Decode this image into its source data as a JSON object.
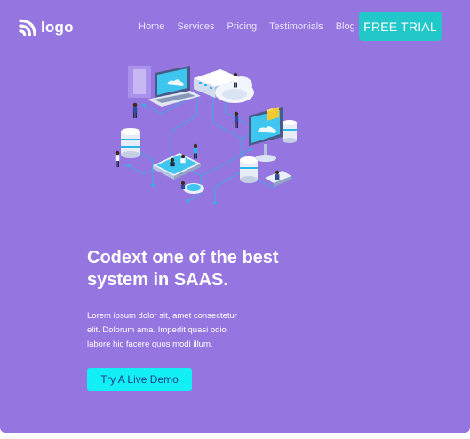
{
  "header": {
    "logo_text": "logo",
    "nav": [
      "Home",
      "Services",
      "Pricing",
      "Testimonials",
      "Blog"
    ],
    "cta_label": "FREE TRIAL"
  },
  "hero": {
    "headline_line1": "Codext one of the best",
    "headline_line2": "system in SAAS.",
    "description_line1": "Lorem ipsum dolor sit, amet consectetur",
    "description_line2": "elit. Dolorum ama. Impedit quasi odio",
    "description_line3": "labore hic facere quos modi illum.",
    "demo_label": "Try A Live Demo"
  },
  "colors": {
    "background": "#9575e0",
    "cta": "#22c7c9",
    "demo_button": "#13f0f5",
    "demo_text": "#1a3b8f"
  }
}
